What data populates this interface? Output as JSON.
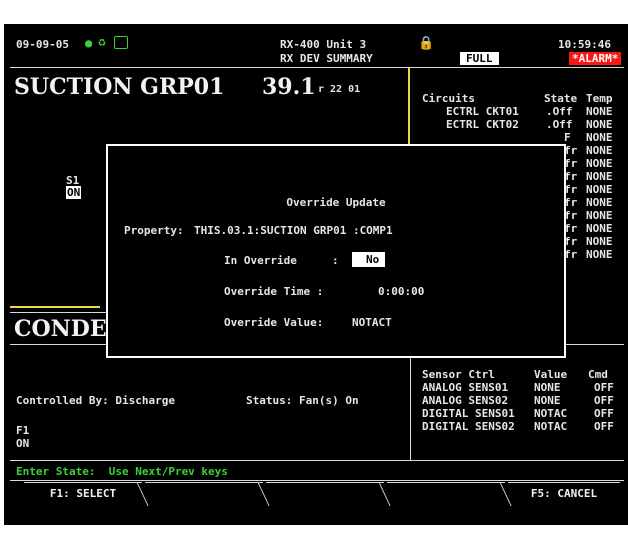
{
  "header": {
    "date": "09-09-05",
    "unit": "RX-400 Unit 3",
    "screen": "RX DEV SUMMARY",
    "time": "10:59:46",
    "mode": "FULL",
    "alarm": "*ALARM*"
  },
  "suction": {
    "title": "SUCTION GRP01",
    "reading": "39.1",
    "subreading": "r 22 01",
    "s1_label": "S1",
    "s1_state": "ON"
  },
  "circuits": {
    "header_circuits": "Circuits",
    "header_state": "State",
    "header_temp": "Temp",
    "rows": [
      {
        "name": "ECTRL CKT01",
        "state": ".Off",
        "temp": "NONE"
      },
      {
        "name": "ECTRL CKT02",
        "state": ".Off",
        "temp": "NONE"
      },
      {
        "name": "",
        "state": "F",
        "temp": "NONE"
      },
      {
        "name": "",
        "state": "fr",
        "temp": "NONE"
      },
      {
        "name": "",
        "state": "fr",
        "temp": "NONE"
      },
      {
        "name": "",
        "state": "fr",
        "temp": "NONE"
      },
      {
        "name": "",
        "state": "fr",
        "temp": "NONE"
      },
      {
        "name": "",
        "state": "fr",
        "temp": "NONE"
      },
      {
        "name": "",
        "state": "fr",
        "temp": "NONE"
      },
      {
        "name": "",
        "state": "fr",
        "temp": "NONE"
      },
      {
        "name": "",
        "state": "fr",
        "temp": "NONE"
      },
      {
        "name": "",
        "state": "fr",
        "temp": "NONE"
      }
    ]
  },
  "condenser": {
    "title": "CONDEN",
    "controlled_by": "Controlled By: Discharge",
    "status": "Status: Fan(s) On",
    "f1_label": "F1",
    "f1_state": "ON"
  },
  "sensors": {
    "header_ctrl": "Sensor Ctrl",
    "header_value": "Value",
    "header_cmd": "Cmd",
    "rows": [
      {
        "name": "ANALOG SENS01",
        "value": "NONE",
        "cmd": "OFF"
      },
      {
        "name": "ANALOG SENS02",
        "value": "NONE",
        "cmd": "OFF"
      },
      {
        "name": "DIGITAL SENS01",
        "value": "NOTAC",
        "cmd": "OFF"
      },
      {
        "name": "DIGITAL SENS02",
        "value": "NOTAC",
        "cmd": "OFF"
      }
    ]
  },
  "modal": {
    "title": "Override Update",
    "property_label": "Property:",
    "property_value": "THIS.03.1:SUCTION GRP01 :COMP1",
    "in_override_label": "In Override",
    "in_override_sep": ":",
    "in_override_value": "No",
    "override_time_label": "Override Time :",
    "override_time_value": "0:00:00",
    "override_value_label": "Override Value:",
    "override_value_value": "NOTACT"
  },
  "status_line": "Enter State:  Use Next/Prev keys",
  "softkeys": {
    "f1": "F1: SELECT",
    "f5": "F5: CANCEL"
  },
  "colors": {
    "accent_green": "#3bd13b",
    "alarm_red": "#ff1414",
    "highlight_yellow": "#f1d34a"
  }
}
